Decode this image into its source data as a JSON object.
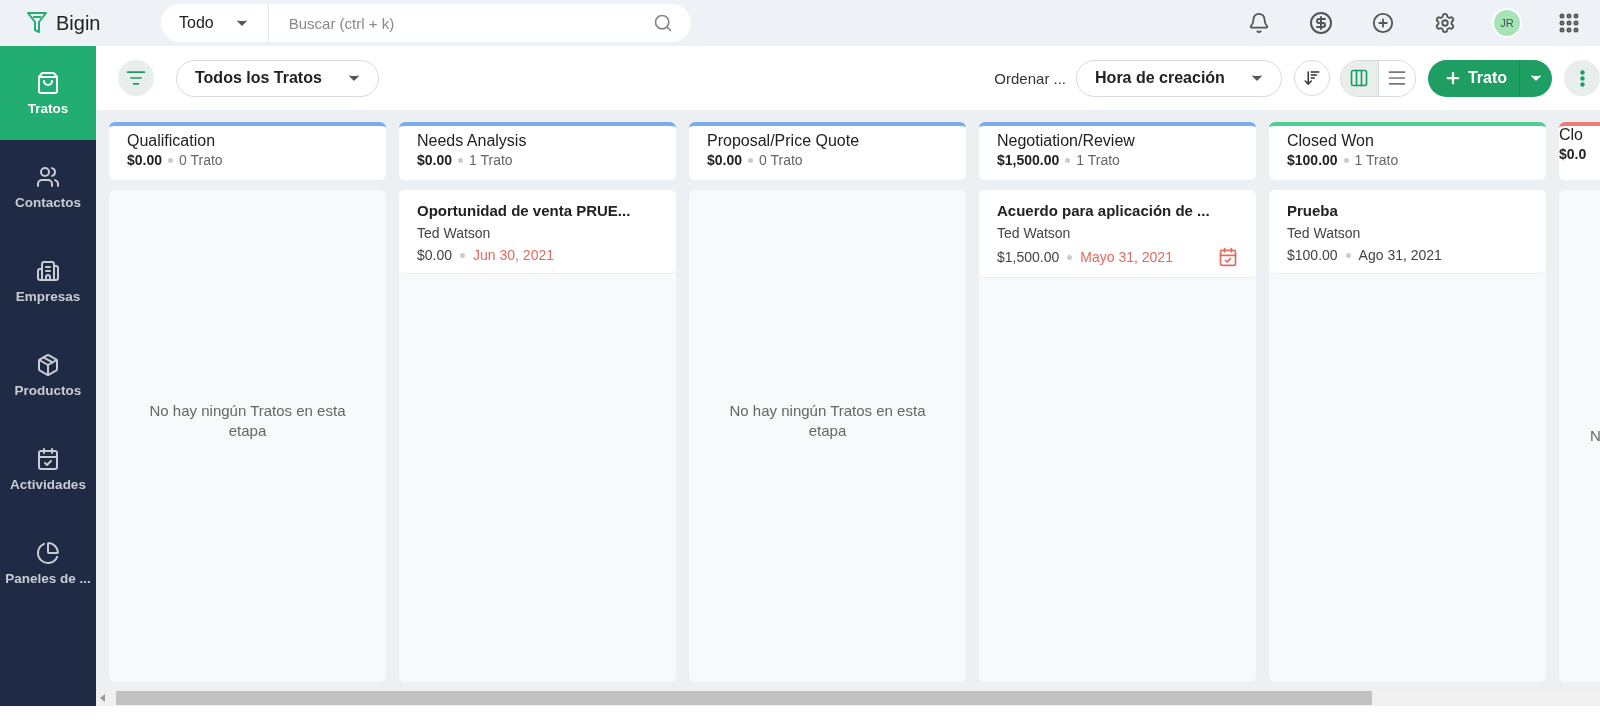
{
  "app": {
    "name": "Bigin"
  },
  "search": {
    "scope": "Todo",
    "placeholder": "Buscar (ctrl + k)"
  },
  "user": {
    "initials": "JR"
  },
  "sidebar": {
    "items": [
      {
        "kind": "deals",
        "label": "Tratos",
        "selected": true
      },
      {
        "kind": "contacts",
        "label": "Contactos",
        "selected": false
      },
      {
        "kind": "companies",
        "label": "Empresas",
        "selected": false
      },
      {
        "kind": "products",
        "label": "Productos",
        "selected": false
      },
      {
        "kind": "activities",
        "label": "Actividades",
        "selected": false
      },
      {
        "kind": "dashboards",
        "label": "Paneles de ...",
        "selected": false
      }
    ]
  },
  "toolbar": {
    "view_filter": "Todos los Tratos",
    "sort_label": "Ordenar ...",
    "sort_field": "Hora de creación",
    "views": [
      {
        "kind": "kanban",
        "selected": true
      },
      {
        "kind": "list",
        "selected": false
      }
    ],
    "create_button": "Trato"
  },
  "stages": [
    {
      "name": "Qualification",
      "color": "#7aacef",
      "amount": "$0.00",
      "count": "0 Trato",
      "empty_text": "No hay ningún Tratos en esta etapa"
    },
    {
      "name": "Needs Analysis",
      "color": "#7aacef",
      "amount": "$0.00",
      "count": "1 Trato",
      "deals": [
        {
          "title": "Oportunidad de venta PRUE...",
          "owner": "Ted Watson",
          "amount": "$0.00",
          "date": "Jun 30, 2021",
          "overdue": true,
          "activity_flag": false
        }
      ]
    },
    {
      "name": "Proposal/Price Quote",
      "color": "#7aacef",
      "amount": "$0.00",
      "count": "0 Trato",
      "empty_text": "No hay ningún Tratos en esta etapa"
    },
    {
      "name": "Negotiation/Review",
      "color": "#7aacef",
      "amount": "$1,500.00",
      "count": "1 Trato",
      "deals": [
        {
          "title": "Acuerdo para aplicación de ...",
          "owner": "Ted Watson",
          "amount": "$1,500.00",
          "date": "Mayo 31, 2021",
          "overdue": true,
          "activity_flag": true
        }
      ]
    },
    {
      "name": "Closed Won",
      "color": "#4fcf95",
      "amount": "$100.00",
      "count": "1 Trato",
      "deals": [
        {
          "title": "Prueba",
          "owner": "Ted Watson",
          "amount": "$100.00",
          "date": "Ago 31, 2021",
          "overdue": false,
          "activity_flag": false
        }
      ]
    },
    {
      "name": "Clo",
      "color": "#ef7c72",
      "amount": "$0.0",
      "empty_text": "N",
      "partial": true
    }
  ]
}
